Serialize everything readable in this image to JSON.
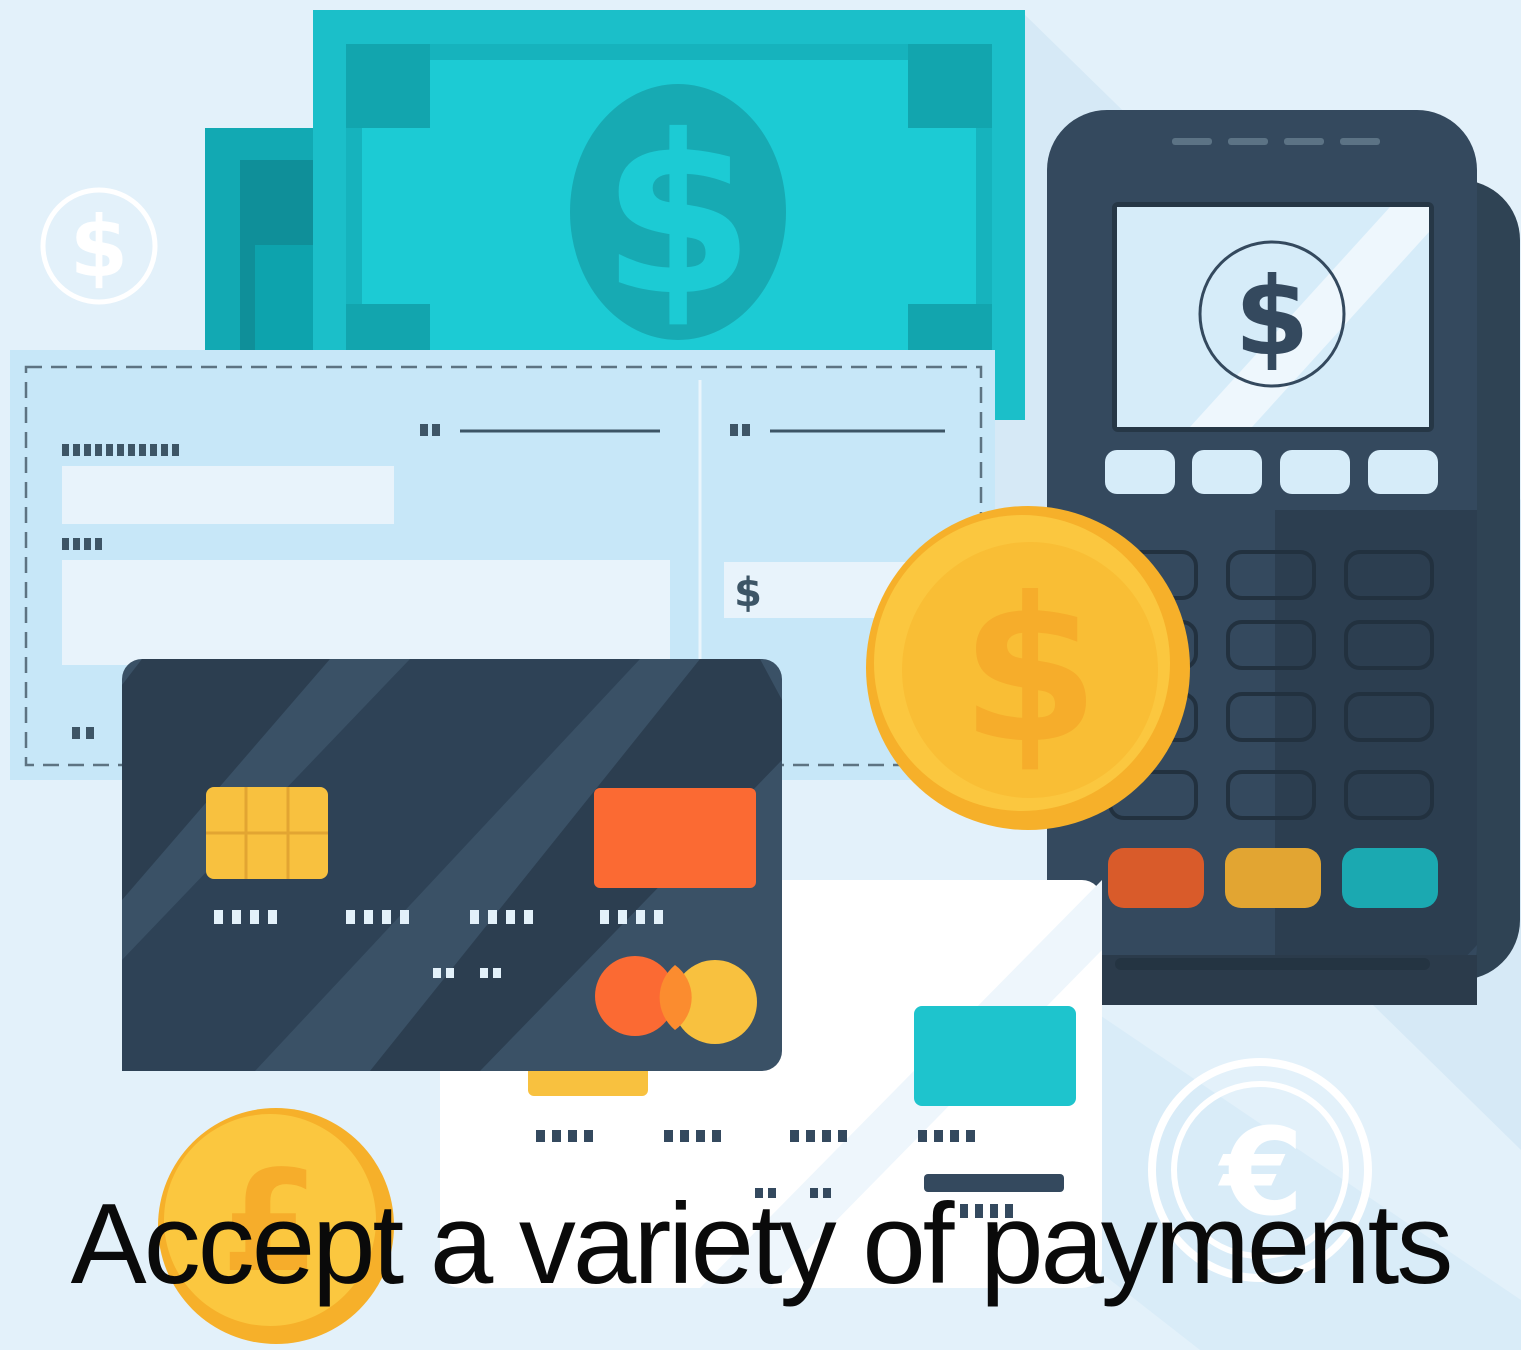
{
  "caption": "Accept a variety of payments",
  "symbols": {
    "dollar": "$",
    "euro": "€",
    "pound": "£"
  },
  "icons": [
    "dollar-badge-icon",
    "banknote-dollar-icon",
    "cheque-icon",
    "payment-terminal-icon",
    "dollar-coin-icon",
    "credit-card-icon",
    "euro-badge-icon",
    "pound-coin-icon"
  ],
  "colors": {
    "background": "#e3f1fa",
    "banknote": "#1cc4cc",
    "cheque": "#c4e6f7",
    "card_dark": "#34495e",
    "card_chip": "#f8c13f",
    "card_accent": "#fb6a33",
    "terminal": "#2c3e50",
    "coin": "#f7b32b",
    "caption_text": "#0a0a0a"
  }
}
